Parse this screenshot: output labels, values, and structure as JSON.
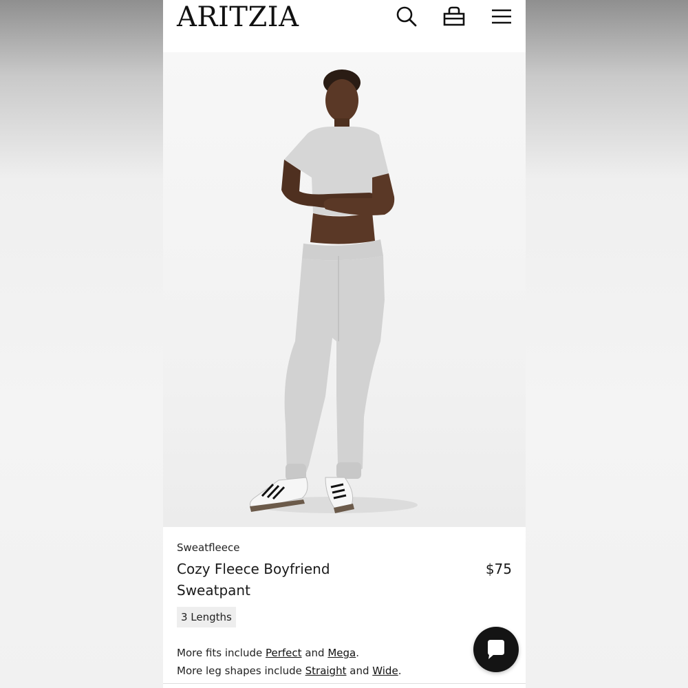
{
  "header": {
    "logo": "ARITZIA",
    "icons": [
      "search-icon",
      "shopping-bag-icon",
      "hamburger-menu-icon"
    ]
  },
  "product": {
    "brand": "Sweatfleece",
    "name": "Cozy Fleece Boyfriend Sweatpant",
    "price": "$75",
    "lengths_badge": "3 Lengths",
    "more_fits": {
      "prefix": "More fits include",
      "link1": "Perfect",
      "joiner": "and",
      "link2": "Mega",
      "suffix": "."
    },
    "more_shapes": {
      "prefix": "More leg shapes include",
      "link1": "Straight",
      "joiner": "and",
      "link2": "Wide",
      "suffix": "."
    }
  },
  "chat": {
    "icon": "chat-bubble-icon"
  },
  "colors": {
    "text": "#1a1a1a",
    "badge_bg": "#eeeeee",
    "chat_bg": "#141414"
  }
}
